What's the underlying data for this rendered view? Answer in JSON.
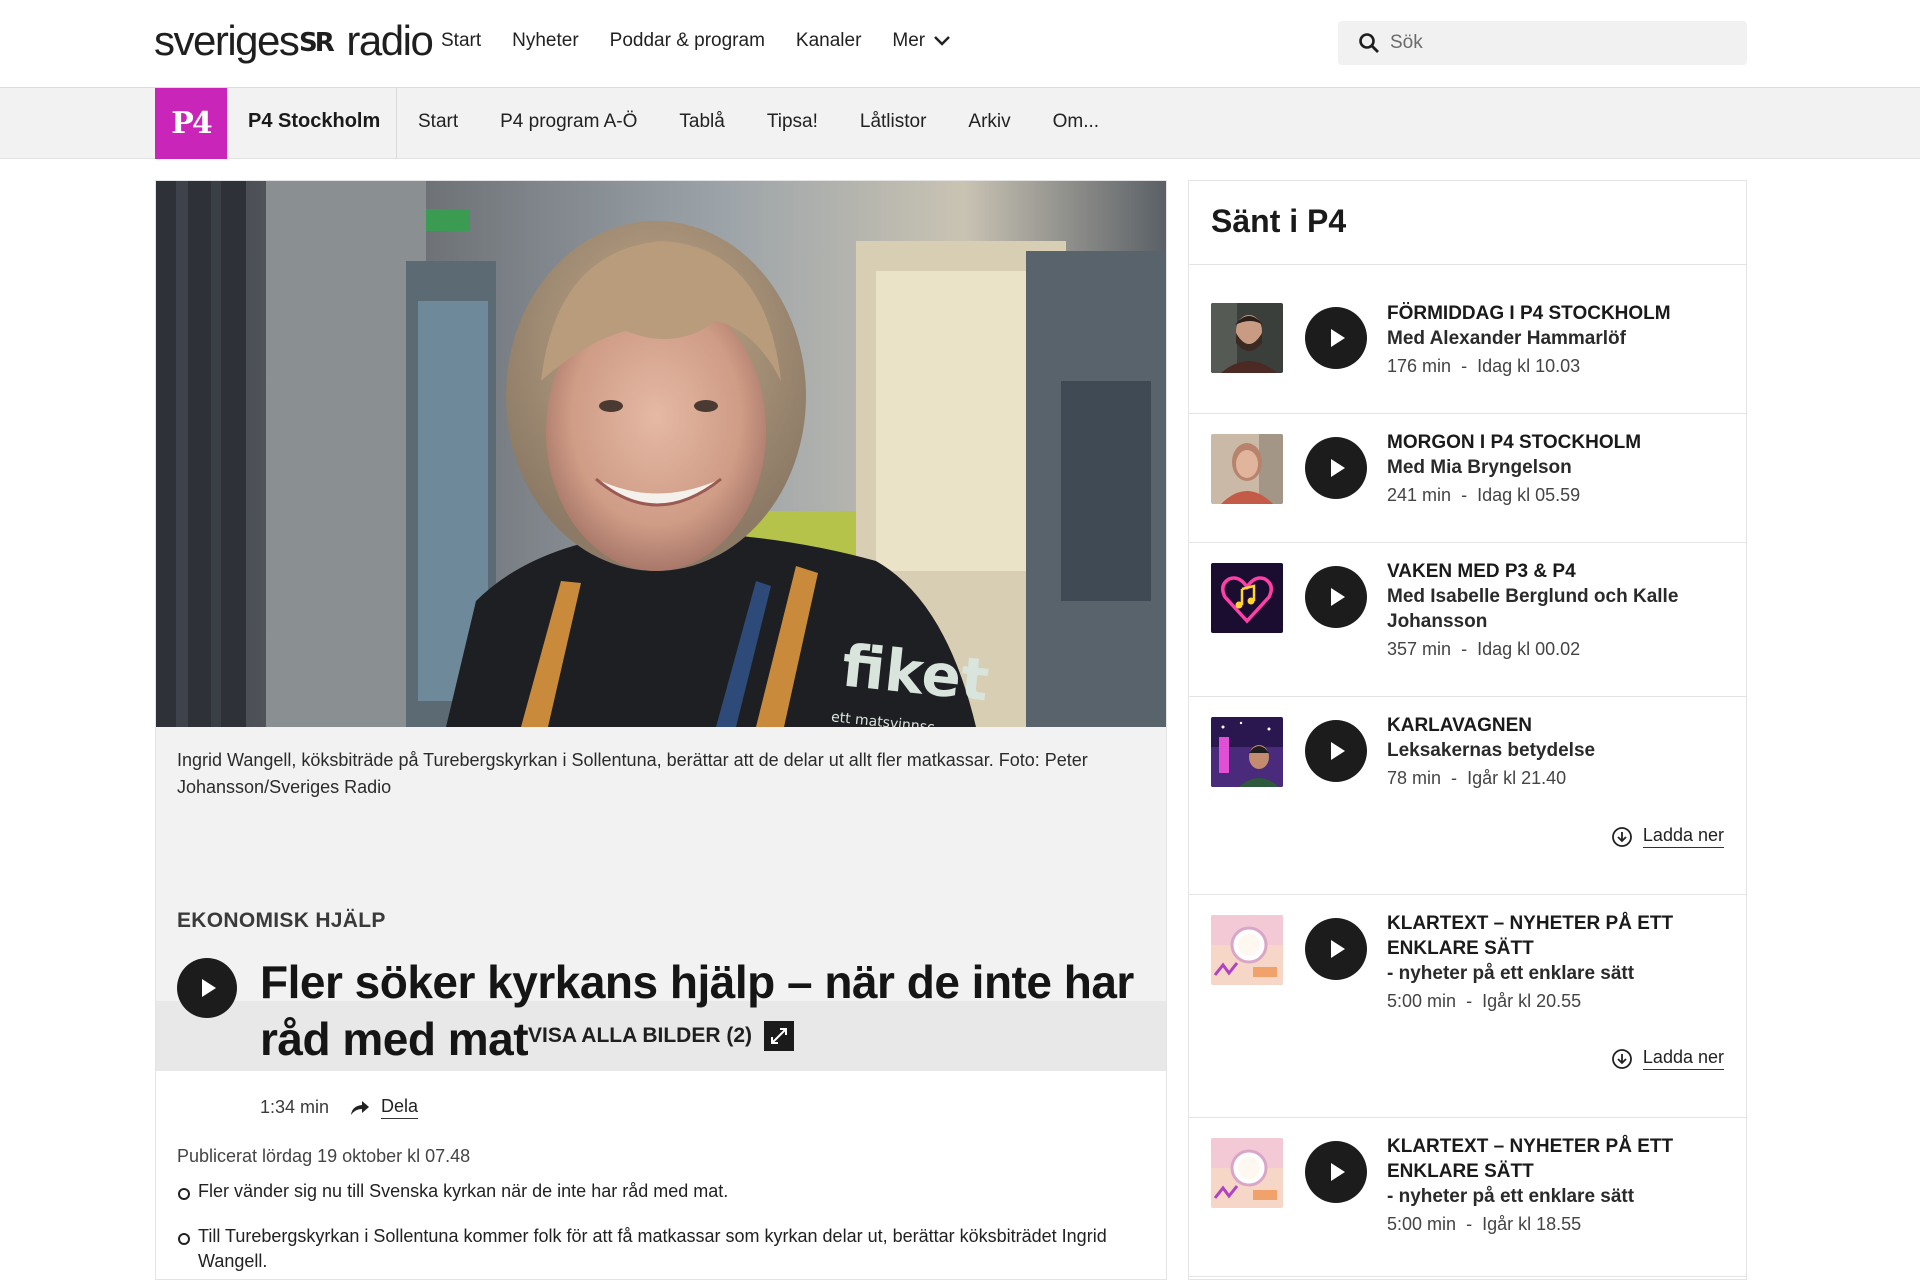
{
  "header": {
    "logo_left": "sveriges",
    "logo_right": "radio",
    "nav": [
      "Start",
      "Nyheter",
      "Poddar & program",
      "Kanaler",
      "Mer"
    ],
    "search_placeholder": "Sök"
  },
  "channel": {
    "logo_text": "P4",
    "title": "P4 Stockholm",
    "nav": [
      "Start",
      "P4 program A-Ö",
      "Tablå",
      "Tipsa!",
      "Låtlistor",
      "Arkiv",
      "Om..."
    ],
    "brand_color": "#c925b8"
  },
  "article": {
    "image_caption": "Ingrid Wangell, köksbiträde på Turebergskyrkan i Sollentuna, berättar att de delar ut allt fler matkassar. Foto: Peter Johansson/Sveriges Radio",
    "shirt_text": "fiket",
    "shirt_subtext": "ett matsvinnsc",
    "view_all_label": "VISA ALLA BILDER (2)",
    "section": "EKONOMISK HJÄLP",
    "headline": "Fler söker kyrkans hjälp – när de inte har råd med mat",
    "duration": "1:34 min",
    "share_label": "Dela",
    "published": "Publicerat lördag 19 oktober kl 07.48",
    "bullets": [
      "Fler vänder sig nu till Svenska kyrkan när de inte har råd med mat.",
      "Till Turebergskyrkan i Sollentuna kommer folk för att få matkassar som kyrkan delar ut, berättar köksbiträdet Ingrid Wangell."
    ]
  },
  "sidebar": {
    "title": "Sänt i P4",
    "download_label": "Ladda ner",
    "episodes": [
      {
        "program": "FÖRMIDDAG I P4 STOCKHOLM",
        "subtitle": "Med Alexander Hammarlöf",
        "duration": "176 min",
        "sep": "-",
        "when": "Idag kl 10.03",
        "thumb": "man-beard"
      },
      {
        "program": "MORGON I P4 STOCKHOLM",
        "subtitle": "Med Mia Bryngelson",
        "duration": "241 min",
        "sep": "-",
        "when": "Idag kl 05.59",
        "thumb": "woman"
      },
      {
        "program": "VAKEN MED P3 & P4",
        "subtitle": "Med Isabelle Berglund och Kalle Johansson",
        "duration": "357 min",
        "sep": "-",
        "when": "Idag kl 00.02",
        "thumb": "heart-note"
      },
      {
        "program": "KARLAVAGNEN",
        "subtitle": "Leksakernas betydelse",
        "duration": "78 min",
        "sep": "-",
        "when": "Igår kl 21.40",
        "thumb": "karlavagnen"
      },
      {
        "program": "KLARTEXT – NYHETER PÅ ETT ENKLARE SÄTT",
        "subtitle": "- nyheter på ett enklare sätt",
        "duration": "5:00 min",
        "sep": "-",
        "when": "Igår kl 20.55",
        "thumb": "klartext"
      },
      {
        "program": "KLARTEXT – NYHETER PÅ ETT ENKLARE SÄTT",
        "subtitle": "- nyheter på ett enklare sätt",
        "duration": "5:00 min",
        "sep": "-",
        "when": "Igår kl 18.55",
        "thumb": "klartext"
      }
    ]
  }
}
